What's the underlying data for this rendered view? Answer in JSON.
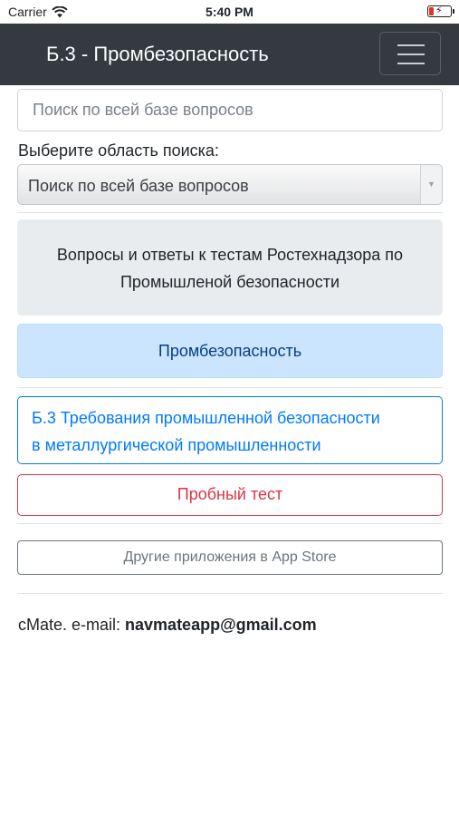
{
  "status_bar": {
    "carrier": "Carrier",
    "time": "5:40 PM",
    "battery_color": "#e5332a"
  },
  "navbar": {
    "title": "Б.3 - Промбезопасность",
    "menu_icon": "hamburger-icon",
    "background": "#343a40"
  },
  "search": {
    "placeholder": "Поиск по всей базе вопросов",
    "value": ""
  },
  "search_area": {
    "label": "Выберите область поиска:",
    "selected": "Поиск по всей базе вопросов"
  },
  "info_box": {
    "line1": "Вопросы и ответы к тестам Ростехнадзора по",
    "line2": "Промышленой безопасности"
  },
  "category": {
    "label": "Промбезопасность",
    "color": "#004085"
  },
  "topic_button": {
    "line1": "Б.3 Требования промышленной безопасности",
    "line2": "в металлургической промышленности",
    "color": "#007bff"
  },
  "trial_button": {
    "label": "Пробный тест",
    "color": "#dc3545"
  },
  "other_apps_button": {
    "label": "Другие приложения в App Store"
  },
  "footer": {
    "prefix": "cMate. e-mail: ",
    "email": "navmateapp@gmail.com"
  }
}
